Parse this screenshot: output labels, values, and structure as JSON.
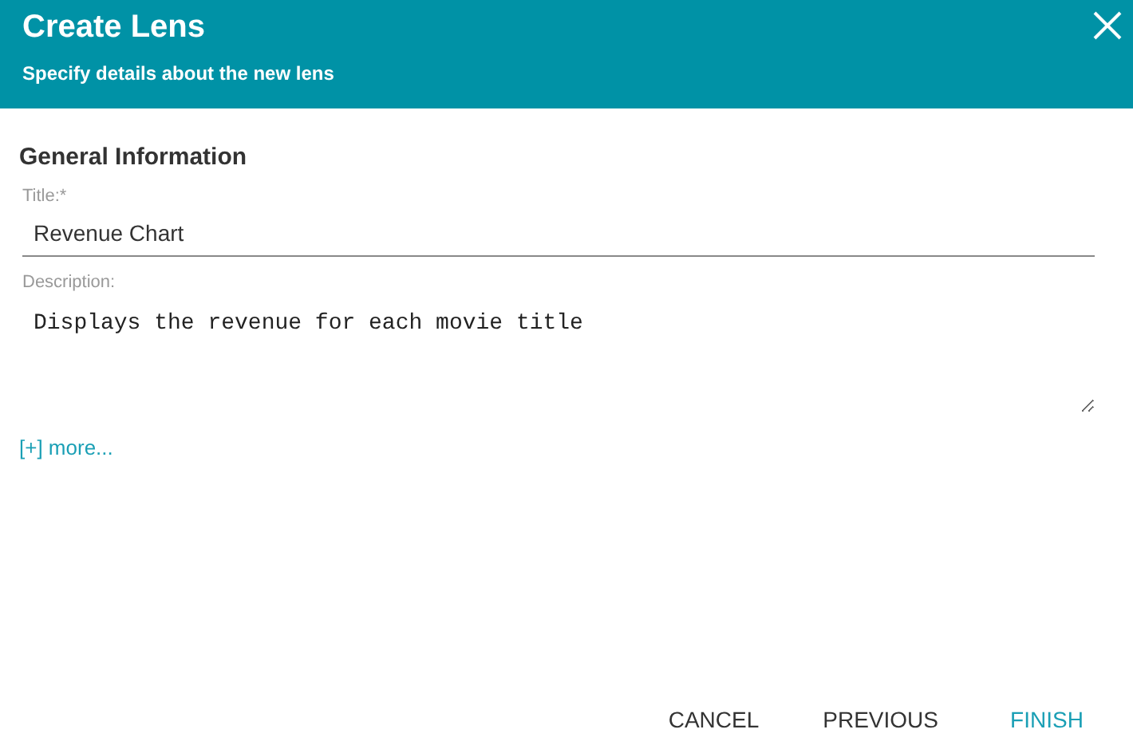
{
  "dialog": {
    "title": "Create Lens",
    "subtitle": "Specify details about the new lens"
  },
  "section": {
    "heading": "General Information"
  },
  "fields": [
    {
      "kind": "input",
      "label": "Title:*",
      "value": "Revenue Chart"
    },
    {
      "kind": "textarea",
      "label": "Description:",
      "value": "Displays the revenue for each movie title"
    }
  ],
  "more_link": "[+] more...",
  "buttons": [
    {
      "label": "CANCEL",
      "kind": "plain"
    },
    {
      "label": "PREVIOUS",
      "kind": "plain"
    },
    {
      "label": "FINISH",
      "kind": "primary"
    }
  ]
}
